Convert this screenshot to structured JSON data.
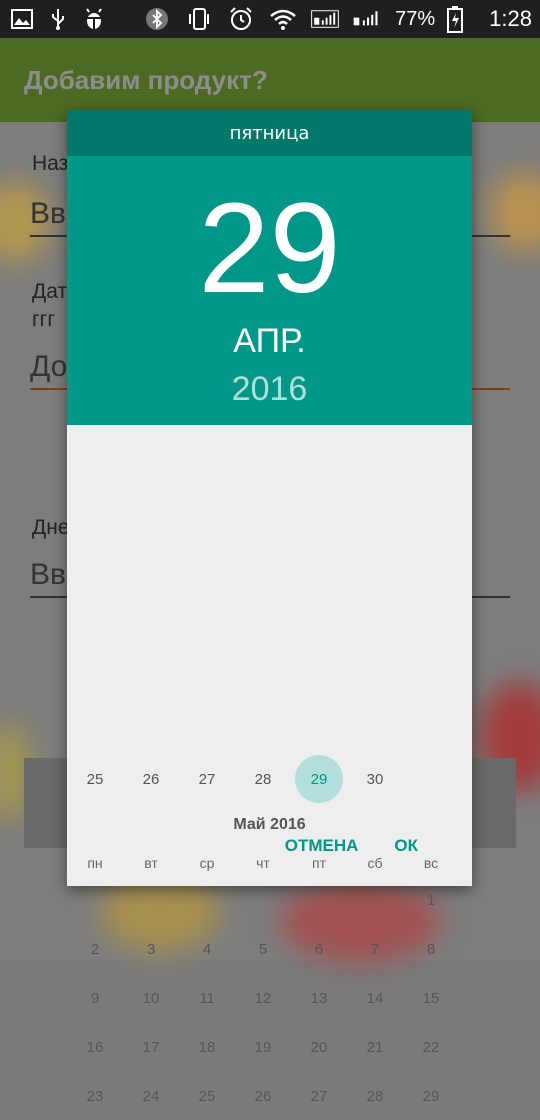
{
  "status_bar": {
    "battery": "77%",
    "time": "1:28"
  },
  "app": {
    "title": "Добавим продукт?",
    "field1_label": "Наз",
    "field1_input": "Вв",
    "field2_label": "Дат",
    "field2_label_line2": "ггг",
    "field2_input": "До",
    "field3_label": "Дне",
    "field3_input": "Вв"
  },
  "picker": {
    "weekday": "пятница",
    "day": "29",
    "month": "АПР.",
    "year": "2016",
    "prev_week": [
      "25",
      "26",
      "27",
      "28",
      "29",
      "30"
    ],
    "selected_day": "29",
    "month_title": "Май 2016",
    "weekdays": [
      "пн",
      "вт",
      "ср",
      "чт",
      "пт",
      "сб",
      "вс"
    ],
    "weeks": [
      [
        "",
        "",
        "",
        "",
        "",
        "",
        "1"
      ],
      [
        "2",
        "3",
        "4",
        "5",
        "6",
        "7",
        "8"
      ],
      [
        "9",
        "10",
        "11",
        "12",
        "13",
        "14",
        "15"
      ],
      [
        "16",
        "17",
        "18",
        "19",
        "20",
        "21",
        "22"
      ],
      [
        "23",
        "24",
        "25",
        "26",
        "27",
        "28",
        "29"
      ]
    ],
    "cancel_label": "ОТМЕНА",
    "ok_label": "ОК"
  }
}
